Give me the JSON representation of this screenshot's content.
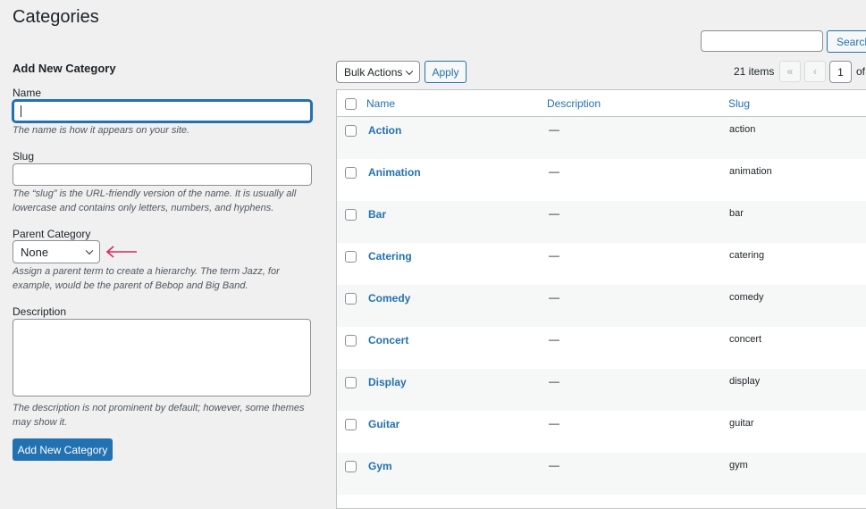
{
  "page_title": "Categories",
  "search": {
    "button": "Search",
    "value": ""
  },
  "form": {
    "heading": "Add New Category",
    "name_label": "Name",
    "name_value": "",
    "name_hint": "The name is how it appears on your site.",
    "slug_label": "Slug",
    "slug_value": "",
    "slug_hint": "The “slug” is the URL-friendly version of the name. It is usually all lowercase and contains only letters, numbers, and hyphens.",
    "parent_label": "Parent Category",
    "parent_value": "None",
    "parent_hint": "Assign a parent term to create a hierarchy. The term Jazz, for example, would be the parent of Bebop and Big Band.",
    "desc_label": "Description",
    "desc_value": "",
    "desc_hint": "The description is not prominent by default; however, some themes may show it.",
    "submit": "Add New Category",
    "arrow_color": "#e0245e"
  },
  "toolbar": {
    "bulk": "Bulk Actions",
    "apply": "Apply",
    "count": "21 items",
    "first": "«",
    "prev": "‹",
    "page": "1",
    "of": "of"
  },
  "table": {
    "headers": {
      "name": "Name",
      "description": "Description",
      "slug": "Slug"
    },
    "rows": [
      {
        "name": "Action",
        "description": "—",
        "slug": "action"
      },
      {
        "name": "Animation",
        "description": "—",
        "slug": "animation"
      },
      {
        "name": "Bar",
        "description": "—",
        "slug": "bar"
      },
      {
        "name": "Catering",
        "description": "—",
        "slug": "catering"
      },
      {
        "name": "Comedy",
        "description": "—",
        "slug": "comedy"
      },
      {
        "name": "Concert",
        "description": "—",
        "slug": "concert"
      },
      {
        "name": "Display",
        "description": "—",
        "slug": "display"
      },
      {
        "name": "Guitar",
        "description": "—",
        "slug": "guitar"
      },
      {
        "name": "Gym",
        "description": "—",
        "slug": "gym"
      }
    ]
  },
  "accent": "#2271b1"
}
